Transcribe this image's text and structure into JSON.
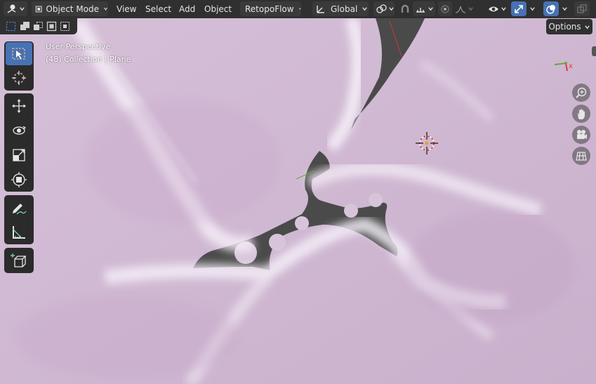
{
  "header": {
    "mode": "Object Mode",
    "menus": [
      "View",
      "Select",
      "Add",
      "Object"
    ],
    "addon": "RetopoFlow",
    "orientation": "Global"
  },
  "tool_settings": {
    "options_label": "Options"
  },
  "viewport": {
    "view_name": "User Perspective",
    "collection_info": "(48) Collection | Plane",
    "axis_x_label": "x"
  },
  "colors": {
    "header_bg": "#303030",
    "accent": "#4772b3",
    "surface": "#dcc8dc",
    "background": "#3d3d3d"
  },
  "icons": {
    "editor_type": "view3d-icon",
    "toolbar": [
      "select-box-icon",
      "cursor-icon",
      "move-icon",
      "rotate-icon",
      "scale-icon",
      "transform-icon",
      "annotate-icon",
      "measure-icon",
      "add-cube-icon"
    ],
    "navigation": [
      "zoom-icon",
      "pan-hand-icon",
      "camera-icon",
      "grid-icon"
    ]
  }
}
